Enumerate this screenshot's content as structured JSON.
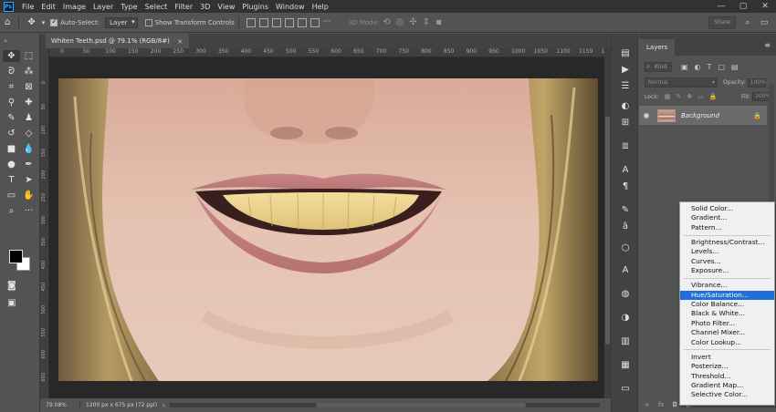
{
  "menubar": {
    "logo": "Ps",
    "items": [
      "File",
      "Edit",
      "Image",
      "Layer",
      "Type",
      "Select",
      "Filter",
      "3D",
      "View",
      "Plugins",
      "Window",
      "Help"
    ],
    "window_controls": [
      "—",
      "▢",
      "✕"
    ]
  },
  "options": {
    "auto_select_label": "Auto-Select:",
    "auto_select_checked": true,
    "auto_select_target": "Layer",
    "transform_label": "Show Transform Controls",
    "transform_checked": false,
    "mode_3d_label": "3D Mode:",
    "share_label": "Share"
  },
  "document": {
    "tab_title": "Whiten Teeth.psd @ 79.1% (RGB/8#)",
    "tab_close": "×",
    "ruler_top_labels": [
      "0",
      "50",
      "100",
      "150",
      "200",
      "250",
      "300",
      "350",
      "400",
      "450",
      "500",
      "550",
      "600",
      "650",
      "700",
      "750",
      "800",
      "850",
      "900",
      "950",
      "1000",
      "1050",
      "1100",
      "1150",
      "1200"
    ],
    "ruler_left_labels": [
      "0",
      "50",
      "100",
      "150",
      "200",
      "250",
      "300",
      "350",
      "400",
      "450",
      "500",
      "550",
      "600",
      "650"
    ]
  },
  "status": {
    "zoom": "79.08%",
    "dimensions": "1200 px x 675 px (72 ppi)",
    "arrow": "›"
  },
  "layers_panel": {
    "title": "Layers",
    "kind_label": "Kind",
    "blend_mode": "Normal",
    "opacity_label": "Opacity:",
    "opacity_value": "100%",
    "lock_label": "Lock:",
    "fill_label": "Fill:",
    "fill_value": "100%",
    "layer": {
      "name": "Background",
      "visible": true,
      "locked": true
    }
  },
  "adjustment_menu": {
    "groups": [
      [
        "Solid Color...",
        "Gradient...",
        "Pattern..."
      ],
      [
        "Brightness/Contrast...",
        "Levels...",
        "Curves...",
        "Exposure..."
      ],
      [
        "Vibrance...",
        "Hue/Saturation...",
        "Color Balance...",
        "Black & White...",
        "Photo Filter...",
        "Channel Mixer...",
        "Color Lookup..."
      ],
      [
        "Invert",
        "Posterize...",
        "Threshold...",
        "Gradient Map...",
        "Selective Color..."
      ]
    ],
    "highlighted": "Hue/Saturation..."
  },
  "colors": {
    "foreground": "#000000",
    "background": "#ffffff",
    "menu_highlight": "#1f6fd8"
  }
}
